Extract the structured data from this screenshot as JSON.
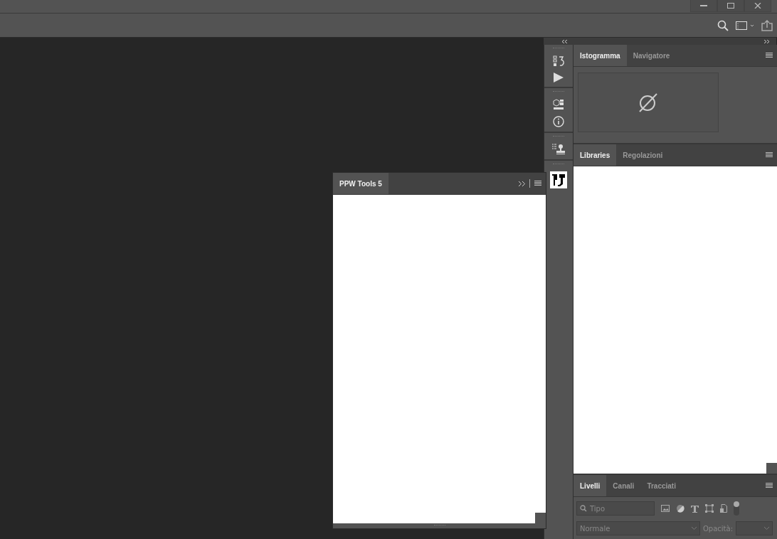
{
  "floating_panel": {
    "tabs": [
      {
        "label": "PPW Tools 5",
        "selected": true
      }
    ]
  },
  "panel_groups": [
    {
      "kind": "histogram",
      "tabs": [
        {
          "label": "Istogramma",
          "selected": true
        },
        {
          "label": "Navigatore",
          "selected": false
        }
      ]
    },
    {
      "kind": "libraries",
      "tabs": [
        {
          "label": "Libraries",
          "selected": true
        },
        {
          "label": "Regolazioni",
          "selected": false
        }
      ]
    },
    {
      "kind": "layers",
      "tabs": [
        {
          "label": "Livelli",
          "selected": true
        },
        {
          "label": "Canali",
          "selected": false
        },
        {
          "label": "Tracciati",
          "selected": false
        }
      ]
    }
  ],
  "layers": {
    "filter": {
      "placeholder": "Tipo"
    },
    "blend_mode": {
      "value": "Normale"
    },
    "opacity": {
      "label": "Opacità:"
    }
  }
}
